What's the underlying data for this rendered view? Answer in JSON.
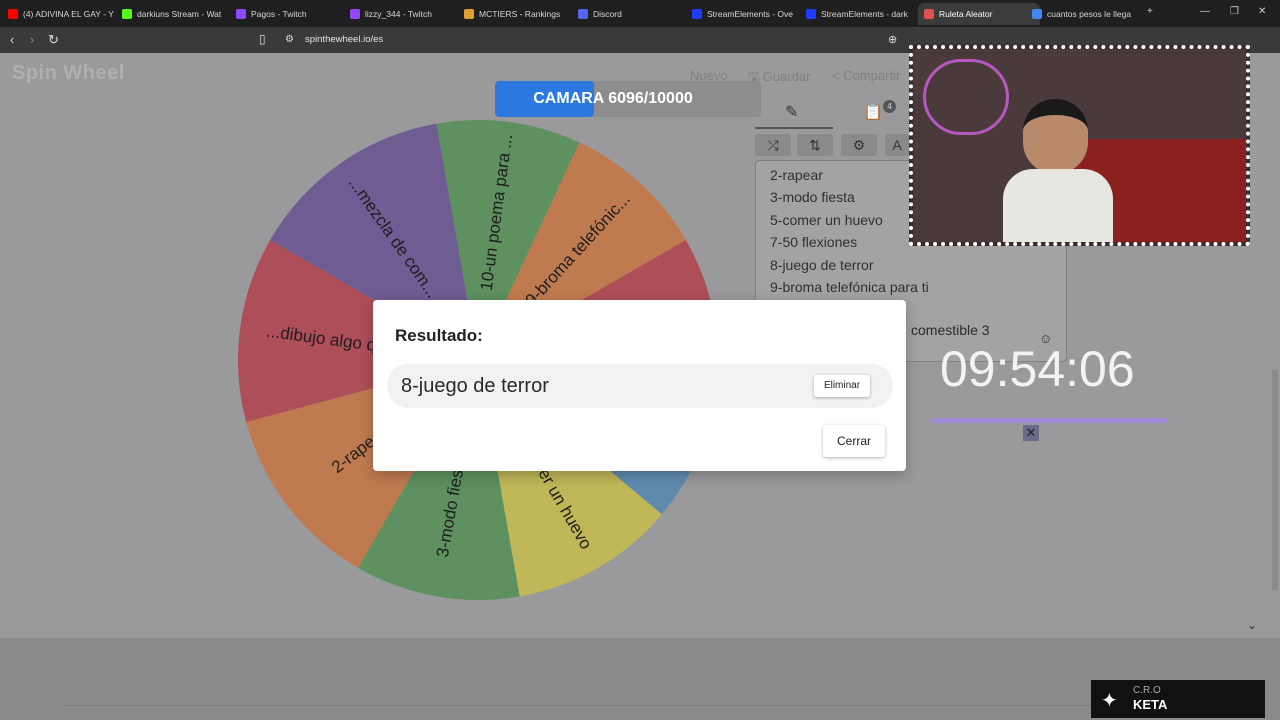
{
  "browser": {
    "tabs": [
      {
        "label": "(4) ADIVINA EL GAY - Y",
        "color": "#ff0000"
      },
      {
        "label": "darkiuns Stream - Wat",
        "color": "#53fc18"
      },
      {
        "label": "Pagos - Twitch",
        "color": "#9146ff"
      },
      {
        "label": "lizzy_344 - Twitch",
        "color": "#9146ff"
      },
      {
        "label": "MCTIERS - Rankings",
        "color": "#e0a030"
      },
      {
        "label": "Discord",
        "color": "#5865f2"
      },
      {
        "label": "StreamElements - Ove",
        "color": "#1e3cff"
      },
      {
        "label": "StreamElements - dark",
        "color": "#1e3cff"
      },
      {
        "label": "Ruleta Aleator",
        "color": "#e05050",
        "active": true
      },
      {
        "label": "cuantos pesos le llega",
        "color": "#4285f4"
      }
    ],
    "new_tab": "+",
    "url": "spinthewheel.io/es"
  },
  "app": {
    "logo": "Spin Wheel",
    "actions": {
      "new": "Nuevo",
      "save": "Guardar",
      "share": "Compartir"
    },
    "progress": {
      "label": "CAMARA",
      "current": "6096",
      "total": "10000",
      "text": "CAMARA  6096/10000",
      "fraction": 0.6096
    },
    "panel_tab_badge": "4",
    "tool_extra": "A",
    "entries": [
      "2-rapear",
      "3-modo fiesta",
      "5-comer un huevo",
      "7-50 flexiones",
      "8-juego de terror",
      "9-broma telefónica para ti"
    ],
    "partial_entry": "comestible 3"
  },
  "wheel": {
    "segments": [
      {
        "label": "10-un poema para ...",
        "color": "#2e8b2e"
      },
      {
        "label": "9-broma telefónic...",
        "color": "#e06010"
      },
      {
        "label": "8-juego de terror",
        "color": "#c01020"
      },
      {
        "label": "7-50 flexiones",
        "color": "#2f7fbf"
      },
      {
        "label": "5-comer un huevo",
        "color": "#e0d020"
      },
      {
        "label": "3-modo fiesta",
        "color": "#2e8b2e"
      },
      {
        "label": "2-rapear",
        "color": "#e06010"
      },
      {
        "label": "...dibujo algo que",
        "color": "#c01020"
      },
      {
        "label": "...mezcla de com...",
        "color": "#4a2a8a"
      }
    ]
  },
  "modal": {
    "title": "Resultado:",
    "result": "8-juego de terror",
    "delete_label": "Eliminar",
    "close_label": "Cerrar"
  },
  "overlay": {
    "timer": "09:54:06",
    "badge_line1": "C.R.O",
    "badge_line2": "KETA"
  }
}
